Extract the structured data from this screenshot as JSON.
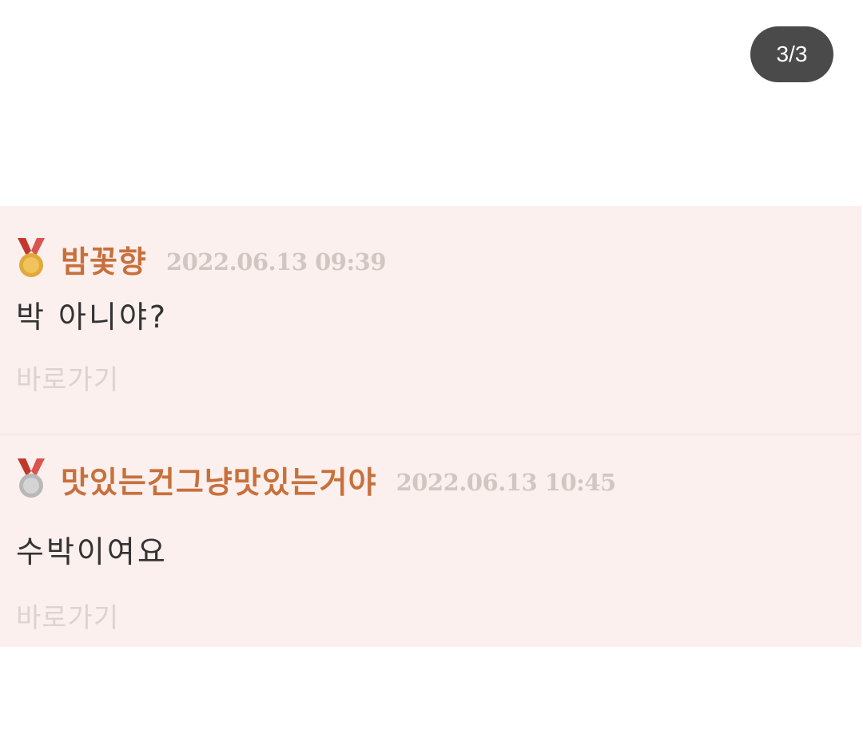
{
  "counter": {
    "label": "3/3"
  },
  "comments": [
    {
      "medal": "gold-medal-icon",
      "nickname": "밤꽃향",
      "timestamp": "2022.06.13 09:39",
      "text": "박 아니야?",
      "link_label": "바로가기"
    },
    {
      "medal": "silver-medal-icon",
      "nickname": "맛있는건그냥맛있는거야",
      "timestamp": "2022.06.13 10:45",
      "text": "수박이여요",
      "link_label": "바로가기"
    }
  ],
  "colors": {
    "panel_bg": "#fbf0ee",
    "nickname": "#c8703c",
    "timestamp": "#d2c6c2",
    "link": "#dcd3d0",
    "counter_bg": "#4a4a4a",
    "ribbon": "#c0392b",
    "gold": "#e2a93a",
    "silver": "#b8b8b8"
  }
}
